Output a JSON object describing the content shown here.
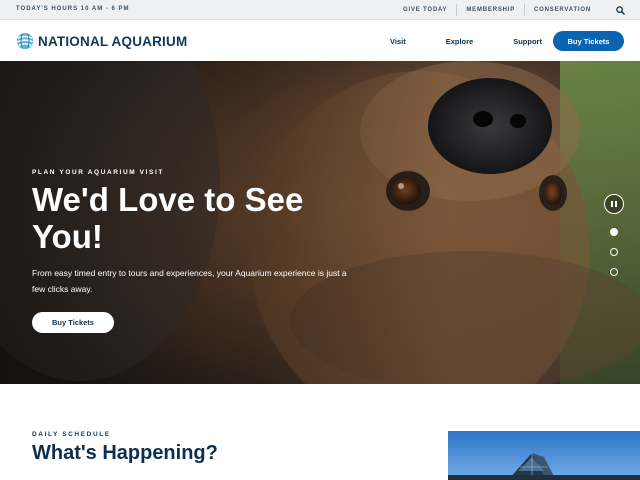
{
  "utility": {
    "hours": "TODAY'S HOURS 10 AM - 6 PM",
    "links": [
      "GIVE TODAY",
      "MEMBERSHIP",
      "CONSERVATION"
    ],
    "search_icon": "search-icon"
  },
  "header": {
    "logo_text": "NATIONAL AQUARIUM",
    "logo_reg": ".",
    "nav": [
      "Visit",
      "Explore",
      "Support"
    ],
    "cta": "Buy Tickets"
  },
  "hero": {
    "eyebrow": "PLAN YOUR AQUARIUM VISIT",
    "title": "We'd Love to See You!",
    "description": "From easy timed entry to tours and experiences, your Aquarium experience is just a few clicks away.",
    "cta": "Buy Tickets",
    "slides": {
      "count": 3,
      "active_index": 0
    }
  },
  "schedule": {
    "eyebrow": "DAILY SCHEDULE",
    "title": "What's Happening?"
  },
  "colors": {
    "brand_navy": "#12385e",
    "cta_blue": "#0b63b4",
    "utility_bg": "#eef1f4"
  }
}
